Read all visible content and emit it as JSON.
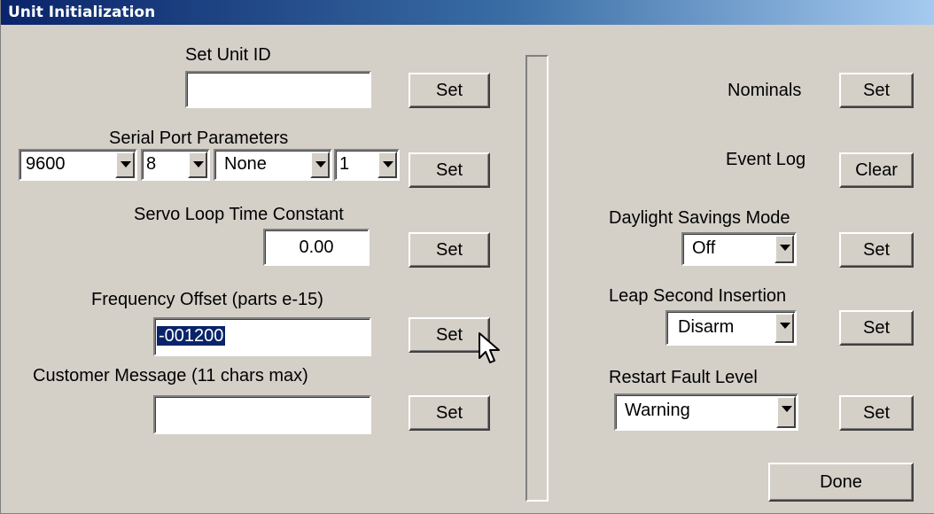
{
  "window": {
    "title": "Unit Initialization"
  },
  "left": {
    "unit_id": {
      "label": "Set Unit ID",
      "value": "",
      "set": "Set"
    },
    "serial": {
      "label": "Serial Port Parameters",
      "baud": "9600",
      "databits": "8",
      "parity": "None",
      "stopbits": "1",
      "set": "Set"
    },
    "servo": {
      "label": "Servo  Loop Time Constant",
      "value": "0.00",
      "set": "Set"
    },
    "freq": {
      "label": "Frequency Offset (parts e-15)",
      "value": "-001200",
      "set": "Set"
    },
    "message": {
      "label": "Customer Message (11 chars max)",
      "value": "",
      "set": "Set"
    }
  },
  "right": {
    "nominals": {
      "label": "Nominals",
      "set": "Set"
    },
    "event_log": {
      "label": "Event Log",
      "clear": "Clear"
    },
    "dst": {
      "label": "Daylight Savings Mode",
      "value": "Off",
      "set": "Set"
    },
    "leap": {
      "label": "Leap Second Insertion",
      "value": "Disarm",
      "set": "Set"
    },
    "fault": {
      "label": "Restart Fault Level",
      "value": "Warning",
      "set": "Set"
    },
    "done": "Done"
  }
}
